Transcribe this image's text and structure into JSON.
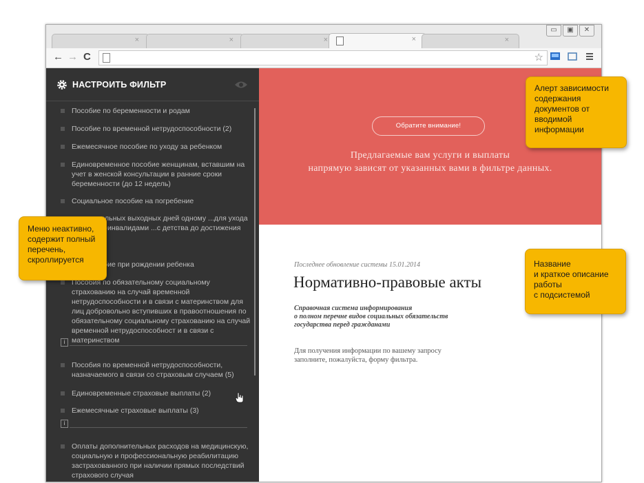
{
  "browser": {
    "tab_close": "×",
    "window_buttons": [
      "▭",
      "▣",
      "✕"
    ],
    "nav": {
      "back": "←",
      "forward": "→",
      "reload": "C"
    },
    "star": "☆"
  },
  "sidebar": {
    "title": "НАСТРОИТЬ ФИЛЬТР",
    "info_glyph": "i",
    "items": [
      {
        "label": "Пособие по беременности и родам"
      },
      {
        "label": "Пособие по временной нетрудоспособности (2)"
      },
      {
        "label": "Ежемесячное пособие по уходу за ребенком"
      },
      {
        "label": "Единовременное пособие женщинам, вставшим на учет в женской консультации в ранние сроки беременности (до 12 недель)"
      },
      {
        "label": "Социальное пособие на погребение"
      },
      {
        "label": "...полнительных выходных дней одному ...для ухода за детьми-инвалидами ...с детства до достижения ими ...т"
      },
      {
        "label": "...ое пособие при рождении ребенка"
      },
      {
        "label": "Пособия по обязательному социальному страхованию на случай временной нетрудоспособности и в связи с материнством для лиц добровольно вступивших в правоотношения по обязательному социальному страхованию на случай временной нетрудоспособност и в связи с материнством"
      },
      {
        "label": "Пособия по временной нетрудоспособности, назначаемого в связи со страховым случаем (5)"
      },
      {
        "label": "Единовременные страховые выплаты (2)"
      },
      {
        "label": "Ежемесячные страховые выплаты (3)"
      },
      {
        "label": "Оплаты дополнительных расходов на медицинскую, социальную и профессиональную реабилитацию застрахованного при наличии прямых последствий страхового случая"
      }
    ]
  },
  "hero": {
    "alert_button": "Обратите внимание!",
    "line1": "Предлагаемые вам услуги и выплаты",
    "line2": "напрямую зависят от указанных вами в фильтре данных."
  },
  "main": {
    "last_update": "Последнее обновление системы 15.01.2014",
    "title": "Нормативно-правовые акты",
    "subtitle": [
      "Справочная система информирования",
      "о полном перечне видов социальных обязательств",
      "государства перед гражданами"
    ],
    "description": [
      "Для получения информации по вашему запросу",
      "заполните, пожалуйста, форму фильтра."
    ]
  },
  "callouts": {
    "alert": [
      "Алерт зависимости",
      "содержания",
      "документов от",
      "вводимой",
      "информации"
    ],
    "menu": [
      "Меню неактивно,",
      "содержит полный",
      "перечень,",
      "скроллируется"
    ],
    "title": [
      "Название",
      "и краткое описание",
      "работы",
      "с подсистемой"
    ]
  },
  "colors": {
    "sidebar_bg": "#333333",
    "hero_bg": "#e2615b",
    "callout_bg": "#f7b700"
  }
}
